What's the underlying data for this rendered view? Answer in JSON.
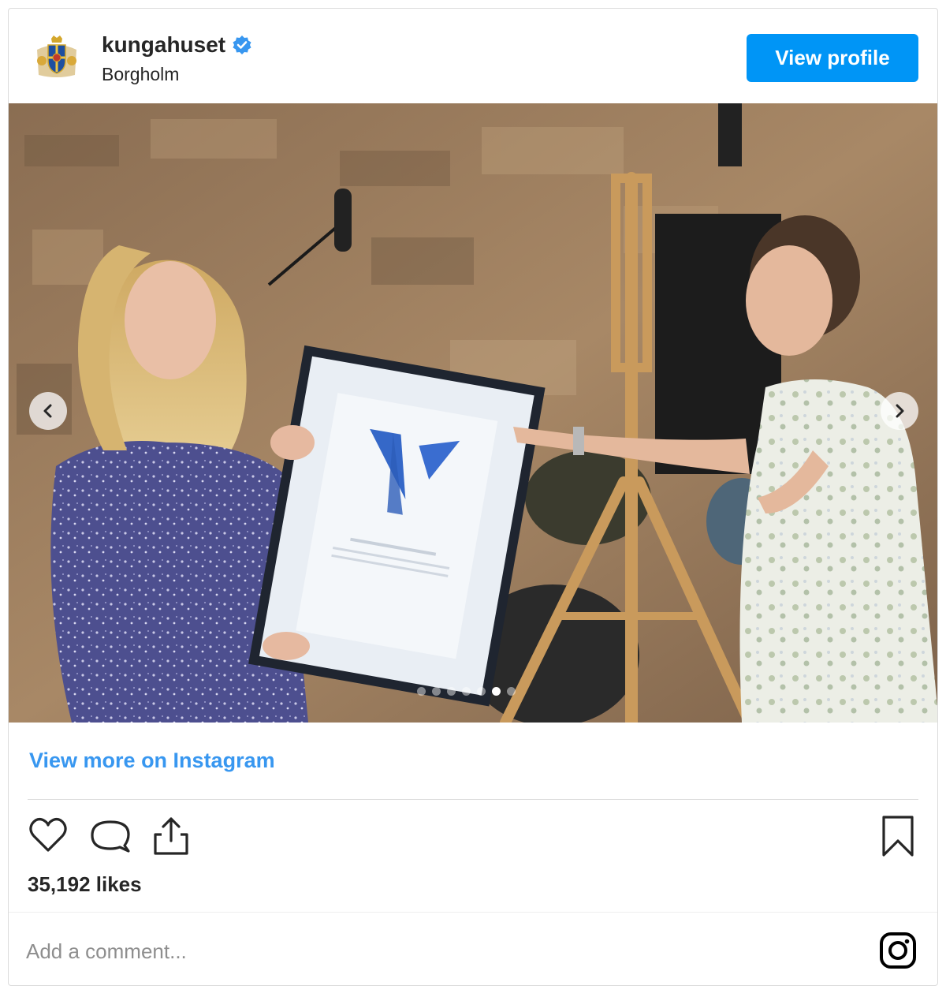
{
  "post": {
    "username": "kungahuset",
    "verified_icon": "verified-badge-icon",
    "location": "Borgholm",
    "view_profile_label": "View profile",
    "avatar_icon": "royal-coat-of-arms-logo"
  },
  "photo": {
    "description_icon": "award-ceremony-photo",
    "prev_icon": "chevron-left-icon",
    "next_icon": "chevron-right-icon",
    "carousel_total": 7,
    "carousel_active_index": 5
  },
  "footer": {
    "view_more_label": "View more on Instagram",
    "likes_text": "35,192 likes",
    "comment_placeholder": "Add a comment...",
    "icons": {
      "like": "heart-icon",
      "comment": "comment-bubble-icon",
      "share": "share-icon",
      "save": "bookmark-icon",
      "instagram": "instagram-logo-icon"
    }
  },
  "colors": {
    "accent": "#0095f6",
    "link": "#3897f0",
    "text": "#262626",
    "muted": "#8e8e8e",
    "border": "#dbdbdb"
  }
}
